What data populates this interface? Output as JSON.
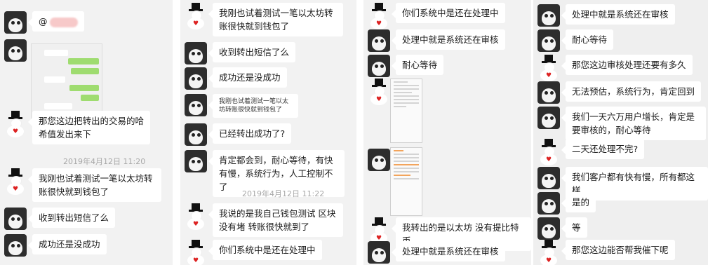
{
  "panel1": {
    "mention": "@",
    "bubble_customer_hash": "那您这边把转出的交易的哈希值发出来下",
    "timestamp": "2019年4月12日 11:20",
    "bubble_tried": "我刚也试着测试一笔以太坊转账很快就到钱包了",
    "bubble_sms": "收到转出短信了么",
    "bubble_success": "成功还是没成功"
  },
  "panel2": {
    "bubble_tried": "我刚也试着测试一笔以太坊转账很快就到钱包了",
    "bubble_sms": "收到转出短信了么",
    "bubble_success": "成功还是没成功",
    "bubble_quote": "我刚也试着测试一笔以太坊转账很快就到钱包了",
    "bubble_transferred": "已经转出成功了?",
    "bubble_patience": "肯定都会到，耐心等待，有快有慢，系统行为，人工控制不了",
    "timestamp": "2019年4月12日 11:22",
    "bubble_my_wallet": "我说的是我自己钱包测试  区块没有堵      转账很快就到了",
    "bubble_still_processing": "你们系统中是还在处理中"
  },
  "panel3": {
    "bubble_still_processing": "你们系统中是还在处理中",
    "bubble_audit": "处理中就是系统还在审核",
    "bubble_wait": "耐心等待",
    "bubble_eth_not_btc": "我转出的是以太坊 没有提比特币",
    "bubble_audit2": "处理中就是系统还在审核"
  },
  "panel4": {
    "bubbles": [
      "处理中就是系统还在审核",
      "耐心等待",
      "那您这边审核处理还要有多久",
      "无法预估，系统行为，肯定回到",
      "我们一天六万用户增长，肯定是要审核的，耐心等待",
      "二天还处理不完?",
      "我们客户都有快有慢，所有都这样",
      "是的",
      "等",
      "那您这边能否帮我催下呢"
    ]
  },
  "colors": {
    "panel_bg": "#f2f2f2",
    "bubble_bg": "#ffffff",
    "green_bubble": "#9fdc70",
    "timestamp": "#a8a8a8"
  },
  "icons": {
    "agent_avatar": "black-white-cat-avatar",
    "user_avatar": "snowman-avatar"
  }
}
